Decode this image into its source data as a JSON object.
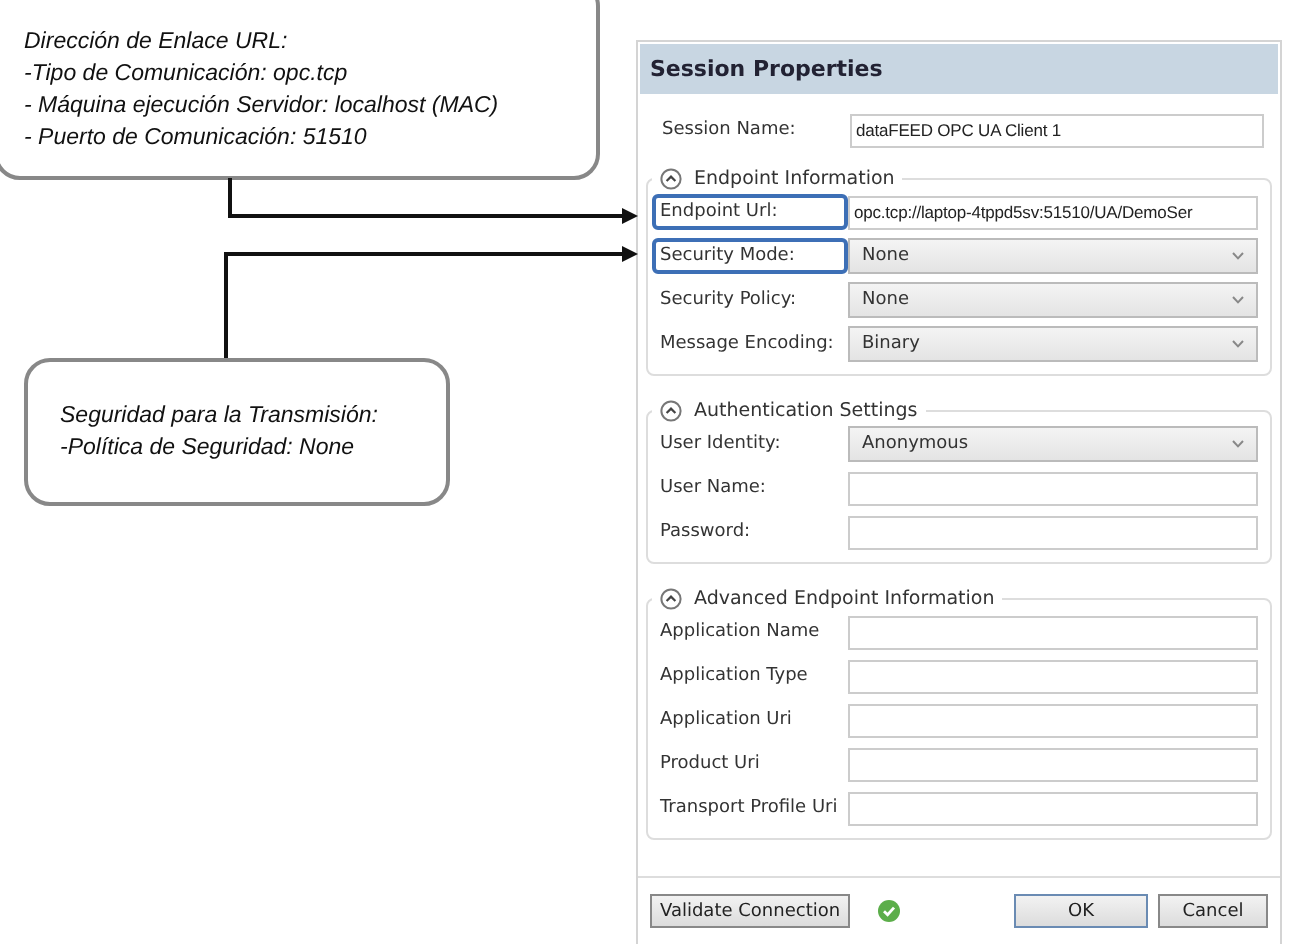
{
  "callouts": [
    {
      "lines": [
        "Dirección de Enlace URL:",
        "-Tipo de Comunicación: opc.tcp",
        "- Máquina ejecución Servidor: localhost (MAC)",
        "- Puerto de Comunicación: 51510"
      ]
    },
    {
      "lines": [
        "Seguridad para la Transmisión:",
        "-Política de Seguridad: None"
      ]
    }
  ],
  "dialog": {
    "title": "Session Properties",
    "session_name": {
      "label": "Session Name:",
      "value": "dataFEED OPC UA Client 1"
    },
    "groups": [
      {
        "title": "Endpoint Information",
        "expanded": true,
        "fields": [
          {
            "label": "Endpoint Url:",
            "kind": "text",
            "value": "opc.tcp://laptop-4tppd5sv:51510/UA/DemoSer",
            "highlighted": true
          },
          {
            "label": "Security Mode:",
            "kind": "combo",
            "value": "None",
            "highlighted": true
          },
          {
            "label": "Security Policy:",
            "kind": "combo",
            "value": "None",
            "highlighted": false
          },
          {
            "label": "Message Encoding:",
            "kind": "combo",
            "value": "Binary",
            "highlighted": false
          }
        ]
      },
      {
        "title": "Authentication Settings",
        "expanded": true,
        "fields": [
          {
            "label": "User Identity:",
            "kind": "combo",
            "value": "Anonymous",
            "highlighted": false
          },
          {
            "label": "User Name:",
            "kind": "text",
            "highlighted": false
          },
          {
            "label": "Password:",
            "kind": "text",
            "highlighted": false
          }
        ]
      },
      {
        "title": "Advanced Endpoint Information",
        "expanded": true,
        "fields": [
          {
            "label": "Application Name",
            "kind": "text",
            "highlighted": false
          },
          {
            "label": "Application Type",
            "kind": "text",
            "highlighted": false
          },
          {
            "label": "Application Uri",
            "kind": "text",
            "highlighted": false
          },
          {
            "label": "Product Uri",
            "kind": "text",
            "highlighted": false
          },
          {
            "label": "Transport Profile Uri",
            "kind": "text",
            "highlighted": false
          }
        ]
      }
    ],
    "validate_button": "Validate Connection",
    "buttons": [
      "OK",
      "Cancel"
    ]
  }
}
